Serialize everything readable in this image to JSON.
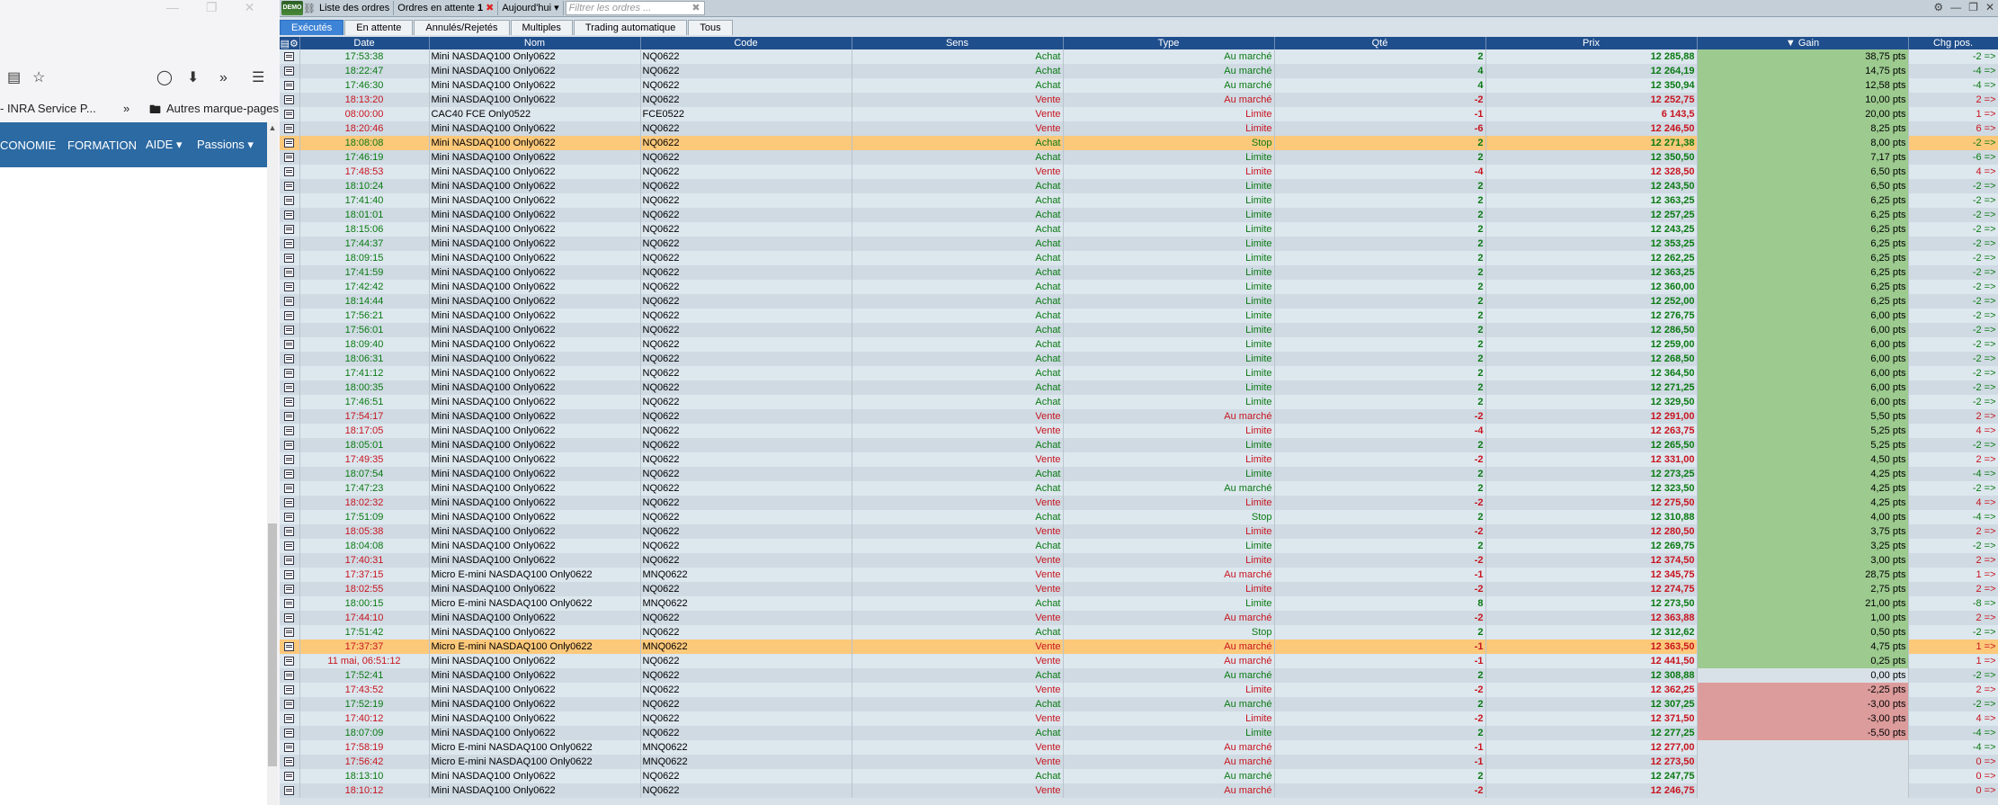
{
  "browser": {
    "bookmark_left": "- INRA Service P...",
    "bookmark_more": "Autres marque-pages",
    "nav": [
      "CONOMIE",
      "FORMATION",
      "AIDE",
      "Passions"
    ]
  },
  "app": {
    "demo_label": "DEMO",
    "top_buttons": {
      "orders_list": "Liste des ordres",
      "pending": "Ordres en attente",
      "pending_count": "1",
      "period": "Aujourd'hui",
      "filter_placeholder": "Filtrer les ordres ..."
    },
    "tabs": [
      "Exécutés",
      "En attente",
      "Annulés/Rejetés",
      "Multiples",
      "Trading automatique",
      "Tous"
    ],
    "columns": [
      "Date",
      "Nom",
      "Code",
      "Sens",
      "Type",
      "Qté",
      "Prix",
      "Gain",
      "Chg pos."
    ],
    "rows": [
      {
        "date": "17:53:38",
        "nom": "Mini NASDAQ100 Only0622",
        "code": "NQ0622",
        "sens": "Achat",
        "type": "Au marché",
        "qte": "2",
        "prix": "12 285,88",
        "gain": "38,75 pts",
        "chg": "-2 =>",
        "gs": "pos"
      },
      {
        "date": "18:22:47",
        "nom": "Mini NASDAQ100 Only0622",
        "code": "NQ0622",
        "sens": "Achat",
        "type": "Au marché",
        "qte": "4",
        "prix": "12 264,19",
        "gain": "14,75 pts",
        "chg": "-4 =>",
        "gs": "pos"
      },
      {
        "date": "17:46:30",
        "nom": "Mini NASDAQ100 Only0622",
        "code": "NQ0622",
        "sens": "Achat",
        "type": "Au marché",
        "qte": "4",
        "prix": "12 350,94",
        "gain": "12,58 pts",
        "chg": "-4 =>",
        "gs": "pos"
      },
      {
        "date": "18:13:20",
        "nom": "Mini NASDAQ100 Only0622",
        "code": "NQ0622",
        "sens": "Vente",
        "type": "Au marché",
        "qte": "-2",
        "prix": "12 252,75",
        "gain": "10,00 pts",
        "chg": "2 =>",
        "gs": "pos"
      },
      {
        "date": "08:00:00",
        "nom": "CAC40 FCE Only0522",
        "code": "FCE0522",
        "sens": "Vente",
        "type": "Limite",
        "qte": "-1",
        "prix": "6 143,5",
        "gain": "20,00 pts",
        "chg": "1 =>",
        "gs": "pos"
      },
      {
        "date": "18:20:46",
        "nom": "Mini NASDAQ100 Only0622",
        "code": "NQ0622",
        "sens": "Vente",
        "type": "Limite",
        "qte": "-6",
        "prix": "12 246,50",
        "gain": "8,25 pts",
        "chg": "6 =>",
        "gs": "pos"
      },
      {
        "date": "18:08:08",
        "nom": "Mini NASDAQ100 Only0622",
        "code": "NQ0622",
        "sens": "Achat",
        "type": "Stop",
        "qte": "2",
        "prix": "12 271,38",
        "gain": "8,00 pts",
        "chg": "-2 =>",
        "gs": "pos",
        "hl": true
      },
      {
        "date": "17:46:19",
        "nom": "Mini NASDAQ100 Only0622",
        "code": "NQ0622",
        "sens": "Achat",
        "type": "Limite",
        "qte": "2",
        "prix": "12 350,50",
        "gain": "7,17 pts",
        "chg": "-6 =>",
        "gs": "pos"
      },
      {
        "date": "17:48:53",
        "nom": "Mini NASDAQ100 Only0622",
        "code": "NQ0622",
        "sens": "Vente",
        "type": "Limite",
        "qte": "-4",
        "prix": "12 328,50",
        "gain": "6,50 pts",
        "chg": "4 =>",
        "gs": "pos"
      },
      {
        "date": "18:10:24",
        "nom": "Mini NASDAQ100 Only0622",
        "code": "NQ0622",
        "sens": "Achat",
        "type": "Limite",
        "qte": "2",
        "prix": "12 243,50",
        "gain": "6,50 pts",
        "chg": "-2 =>",
        "gs": "pos"
      },
      {
        "date": "17:41:40",
        "nom": "Mini NASDAQ100 Only0622",
        "code": "NQ0622",
        "sens": "Achat",
        "type": "Limite",
        "qte": "2",
        "prix": "12 363,25",
        "gain": "6,25 pts",
        "chg": "-2 =>",
        "gs": "pos"
      },
      {
        "date": "18:01:01",
        "nom": "Mini NASDAQ100 Only0622",
        "code": "NQ0622",
        "sens": "Achat",
        "type": "Limite",
        "qte": "2",
        "prix": "12 257,25",
        "gain": "6,25 pts",
        "chg": "-2 =>",
        "gs": "pos"
      },
      {
        "date": "18:15:06",
        "nom": "Mini NASDAQ100 Only0622",
        "code": "NQ0622",
        "sens": "Achat",
        "type": "Limite",
        "qte": "2",
        "prix": "12 243,25",
        "gain": "6,25 pts",
        "chg": "-2 =>",
        "gs": "pos"
      },
      {
        "date": "17:44:37",
        "nom": "Mini NASDAQ100 Only0622",
        "code": "NQ0622",
        "sens": "Achat",
        "type": "Limite",
        "qte": "2",
        "prix": "12 353,25",
        "gain": "6,25 pts",
        "chg": "-2 =>",
        "gs": "pos"
      },
      {
        "date": "18:09:15",
        "nom": "Mini NASDAQ100 Only0622",
        "code": "NQ0622",
        "sens": "Achat",
        "type": "Limite",
        "qte": "2",
        "prix": "12 262,25",
        "gain": "6,25 pts",
        "chg": "-2 =>",
        "gs": "pos"
      },
      {
        "date": "17:41:59",
        "nom": "Mini NASDAQ100 Only0622",
        "code": "NQ0622",
        "sens": "Achat",
        "type": "Limite",
        "qte": "2",
        "prix": "12 363,25",
        "gain": "6,25 pts",
        "chg": "-2 =>",
        "gs": "pos"
      },
      {
        "date": "17:42:42",
        "nom": "Mini NASDAQ100 Only0622",
        "code": "NQ0622",
        "sens": "Achat",
        "type": "Limite",
        "qte": "2",
        "prix": "12 360,00",
        "gain": "6,25 pts",
        "chg": "-2 =>",
        "gs": "pos"
      },
      {
        "date": "18:14:44",
        "nom": "Mini NASDAQ100 Only0622",
        "code": "NQ0622",
        "sens": "Achat",
        "type": "Limite",
        "qte": "2",
        "prix": "12 252,00",
        "gain": "6,25 pts",
        "chg": "-2 =>",
        "gs": "pos"
      },
      {
        "date": "17:56:21",
        "nom": "Mini NASDAQ100 Only0622",
        "code": "NQ0622",
        "sens": "Achat",
        "type": "Limite",
        "qte": "2",
        "prix": "12 276,75",
        "gain": "6,00 pts",
        "chg": "-2 =>",
        "gs": "pos"
      },
      {
        "date": "17:56:01",
        "nom": "Mini NASDAQ100 Only0622",
        "code": "NQ0622",
        "sens": "Achat",
        "type": "Limite",
        "qte": "2",
        "prix": "12 286,50",
        "gain": "6,00 pts",
        "chg": "-2 =>",
        "gs": "pos"
      },
      {
        "date": "18:09:40",
        "nom": "Mini NASDAQ100 Only0622",
        "code": "NQ0622",
        "sens": "Achat",
        "type": "Limite",
        "qte": "2",
        "prix": "12 259,00",
        "gain": "6,00 pts",
        "chg": "-2 =>",
        "gs": "pos"
      },
      {
        "date": "18:06:31",
        "nom": "Mini NASDAQ100 Only0622",
        "code": "NQ0622",
        "sens": "Achat",
        "type": "Limite",
        "qte": "2",
        "prix": "12 268,50",
        "gain": "6,00 pts",
        "chg": "-2 =>",
        "gs": "pos"
      },
      {
        "date": "17:41:12",
        "nom": "Mini NASDAQ100 Only0622",
        "code": "NQ0622",
        "sens": "Achat",
        "type": "Limite",
        "qte": "2",
        "prix": "12 364,50",
        "gain": "6,00 pts",
        "chg": "-2 =>",
        "gs": "pos"
      },
      {
        "date": "18:00:35",
        "nom": "Mini NASDAQ100 Only0622",
        "code": "NQ0622",
        "sens": "Achat",
        "type": "Limite",
        "qte": "2",
        "prix": "12 271,25",
        "gain": "6,00 pts",
        "chg": "-2 =>",
        "gs": "pos"
      },
      {
        "date": "17:46:51",
        "nom": "Mini NASDAQ100 Only0622",
        "code": "NQ0622",
        "sens": "Achat",
        "type": "Limite",
        "qte": "2",
        "prix": "12 329,50",
        "gain": "6,00 pts",
        "chg": "-2 =>",
        "gs": "pos"
      },
      {
        "date": "17:54:17",
        "nom": "Mini NASDAQ100 Only0622",
        "code": "NQ0622",
        "sens": "Vente",
        "type": "Au marché",
        "qte": "-2",
        "prix": "12 291,00",
        "gain": "5,50 pts",
        "chg": "2 =>",
        "gs": "pos"
      },
      {
        "date": "18:17:05",
        "nom": "Mini NASDAQ100 Only0622",
        "code": "NQ0622",
        "sens": "Vente",
        "type": "Limite",
        "qte": "-4",
        "prix": "12 263,75",
        "gain": "5,25 pts",
        "chg": "4 =>",
        "gs": "pos"
      },
      {
        "date": "18:05:01",
        "nom": "Mini NASDAQ100 Only0622",
        "code": "NQ0622",
        "sens": "Achat",
        "type": "Limite",
        "qte": "2",
        "prix": "12 265,50",
        "gain": "5,25 pts",
        "chg": "-2 =>",
        "gs": "pos"
      },
      {
        "date": "17:49:35",
        "nom": "Mini NASDAQ100 Only0622",
        "code": "NQ0622",
        "sens": "Vente",
        "type": "Limite",
        "qte": "-2",
        "prix": "12 331,00",
        "gain": "4,50 pts",
        "chg": "2 =>",
        "gs": "pos"
      },
      {
        "date": "18:07:54",
        "nom": "Mini NASDAQ100 Only0622",
        "code": "NQ0622",
        "sens": "Achat",
        "type": "Limite",
        "qte": "2",
        "prix": "12 273,25",
        "gain": "4,25 pts",
        "chg": "-4 =>",
        "gs": "pos"
      },
      {
        "date": "17:47:23",
        "nom": "Mini NASDAQ100 Only0622",
        "code": "NQ0622",
        "sens": "Achat",
        "type": "Au marché",
        "qte": "2",
        "prix": "12 323,50",
        "gain": "4,25 pts",
        "chg": "-2 =>",
        "gs": "pos"
      },
      {
        "date": "18:02:32",
        "nom": "Mini NASDAQ100 Only0622",
        "code": "NQ0622",
        "sens": "Vente",
        "type": "Limite",
        "qte": "-2",
        "prix": "12 275,50",
        "gain": "4,25 pts",
        "chg": "4 =>",
        "gs": "pos"
      },
      {
        "date": "17:51:09",
        "nom": "Mini NASDAQ100 Only0622",
        "code": "NQ0622",
        "sens": "Achat",
        "type": "Stop",
        "qte": "2",
        "prix": "12 310,88",
        "gain": "4,00 pts",
        "chg": "-4 =>",
        "gs": "pos"
      },
      {
        "date": "18:05:38",
        "nom": "Mini NASDAQ100 Only0622",
        "code": "NQ0622",
        "sens": "Vente",
        "type": "Limite",
        "qte": "-2",
        "prix": "12 280,50",
        "gain": "3,75 pts",
        "chg": "2 =>",
        "gs": "pos"
      },
      {
        "date": "18:04:08",
        "nom": "Mini NASDAQ100 Only0622",
        "code": "NQ0622",
        "sens": "Achat",
        "type": "Limite",
        "qte": "2",
        "prix": "12 269,75",
        "gain": "3,25 pts",
        "chg": "-2 =>",
        "gs": "pos"
      },
      {
        "date": "17:40:31",
        "nom": "Mini NASDAQ100 Only0622",
        "code": "NQ0622",
        "sens": "Vente",
        "type": "Limite",
        "qte": "-2",
        "prix": "12 374,50",
        "gain": "3,00 pts",
        "chg": "2 =>",
        "gs": "pos"
      },
      {
        "date": "17:37:15",
        "nom": "Micro E-mini NASDAQ100 Only0622",
        "code": "MNQ0622",
        "sens": "Vente",
        "type": "Au marché",
        "qte": "-1",
        "prix": "12 345,75",
        "gain": "28,75 pts",
        "chg": "1 =>",
        "gs": "pos"
      },
      {
        "date": "18:02:55",
        "nom": "Mini NASDAQ100 Only0622",
        "code": "NQ0622",
        "sens": "Vente",
        "type": "Limite",
        "qte": "-2",
        "prix": "12 274,75",
        "gain": "2,75 pts",
        "chg": "2 =>",
        "gs": "pos"
      },
      {
        "date": "18:00:15",
        "nom": "Micro E-mini NASDAQ100 Only0622",
        "code": "MNQ0622",
        "sens": "Achat",
        "type": "Limite",
        "qte": "8",
        "prix": "12 273,50",
        "gain": "21,00 pts",
        "chg": "-8 =>",
        "gs": "pos"
      },
      {
        "date": "17:44:10",
        "nom": "Mini NASDAQ100 Only0622",
        "code": "NQ0622",
        "sens": "Vente",
        "type": "Au marché",
        "qte": "-2",
        "prix": "12 363,88",
        "gain": "1,00 pts",
        "chg": "2 =>",
        "gs": "pos"
      },
      {
        "date": "17:51:42",
        "nom": "Mini NASDAQ100 Only0622",
        "code": "NQ0622",
        "sens": "Achat",
        "type": "Stop",
        "qte": "2",
        "prix": "12 312,62",
        "gain": "0,50 pts",
        "chg": "-2 =>",
        "gs": "pos"
      },
      {
        "date": "17:37:37",
        "nom": "Micro E-mini NASDAQ100 Only0622",
        "code": "MNQ0622",
        "sens": "Vente",
        "type": "Au marché",
        "qte": "-1",
        "prix": "12 363,50",
        "gain": "4,75 pts",
        "chg": "1 =>",
        "gs": "pos",
        "hl": true
      },
      {
        "date": "11 mai, 06:51:12",
        "nom": "Mini NASDAQ100 Only0622",
        "code": "NQ0622",
        "sens": "Vente",
        "type": "Au marché",
        "qte": "-1",
        "prix": "12 441,50",
        "gain": "0,25 pts",
        "chg": "1 =>",
        "gs": "pos"
      },
      {
        "date": "17:52:41",
        "nom": "Mini NASDAQ100 Only0622",
        "code": "NQ0622",
        "sens": "Achat",
        "type": "Au marché",
        "qte": "2",
        "prix": "12 308,88",
        "gain": "0,00 pts",
        "chg": "-2 =>",
        "gs": "nil"
      },
      {
        "date": "17:43:52",
        "nom": "Mini NASDAQ100 Only0622",
        "code": "NQ0622",
        "sens": "Vente",
        "type": "Limite",
        "qte": "-2",
        "prix": "12 362,25",
        "gain": "-2,25 pts",
        "chg": "2 =>",
        "gs": "neg"
      },
      {
        "date": "17:52:19",
        "nom": "Mini NASDAQ100 Only0622",
        "code": "NQ0622",
        "sens": "Achat",
        "type": "Au marché",
        "qte": "2",
        "prix": "12 307,25",
        "gain": "-3,00 pts",
        "chg": "-2 =>",
        "gs": "neg"
      },
      {
        "date": "17:40:12",
        "nom": "Mini NASDAQ100 Only0622",
        "code": "NQ0622",
        "sens": "Vente",
        "type": "Limite",
        "qte": "-2",
        "prix": "12 371,50",
        "gain": "-3,00 pts",
        "chg": "4 =>",
        "gs": "neg"
      },
      {
        "date": "18:07:09",
        "nom": "Mini NASDAQ100 Only0622",
        "code": "NQ0622",
        "sens": "Achat",
        "type": "Limite",
        "qte": "2",
        "prix": "12 277,25",
        "gain": "-5,50 pts",
        "chg": "-4 =>",
        "gs": "neg"
      },
      {
        "date": "17:58:19",
        "nom": "Micro E-mini NASDAQ100 Only0622",
        "code": "MNQ0622",
        "sens": "Vente",
        "type": "Au marché",
        "qte": "-1",
        "prix": "12 277,00",
        "gain": "",
        "chg": "-4 =>",
        "gs": "nil"
      },
      {
        "date": "17:56:42",
        "nom": "Micro E-mini NASDAQ100 Only0622",
        "code": "MNQ0622",
        "sens": "Vente",
        "type": "Au marché",
        "qte": "-1",
        "prix": "12 273,50",
        "gain": "",
        "chg": "0 =>",
        "gs": "nil"
      },
      {
        "date": "18:13:10",
        "nom": "Mini NASDAQ100 Only0622",
        "code": "NQ0622",
        "sens": "Achat",
        "type": "Au marché",
        "qte": "2",
        "prix": "12 247,75",
        "gain": "",
        "chg": "0 =>",
        "gs": "nil"
      },
      {
        "date": "18:10:12",
        "nom": "Mini NASDAQ100 Only0622",
        "code": "NQ0622",
        "sens": "Vente",
        "type": "Au marché",
        "qte": "-2",
        "prix": "12 246,75",
        "gain": "",
        "chg": "0 =>",
        "gs": "nil"
      }
    ]
  }
}
